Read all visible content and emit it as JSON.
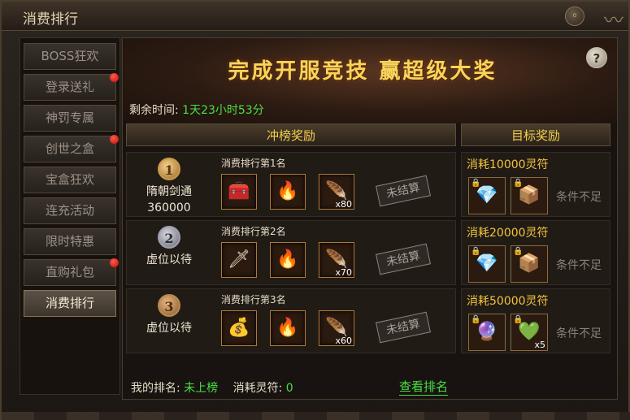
{
  "window": {
    "title": "消费排行",
    "close_glyph": "◦"
  },
  "sidebar": {
    "items": [
      {
        "label": "BOSS狂欢",
        "dot": false,
        "active": false
      },
      {
        "label": "登录送礼",
        "dot": true,
        "active": false
      },
      {
        "label": "神罚专属",
        "dot": false,
        "active": false
      },
      {
        "label": "创世之盒",
        "dot": true,
        "active": false
      },
      {
        "label": "宝盒狂欢",
        "dot": false,
        "active": false
      },
      {
        "label": "连充活动",
        "dot": false,
        "active": false
      },
      {
        "label": "限时特惠",
        "dot": false,
        "active": false
      },
      {
        "label": "直购礼包",
        "dot": true,
        "active": false
      },
      {
        "label": "消费排行",
        "dot": false,
        "active": true
      }
    ]
  },
  "banner": {
    "title": "完成开服竞技  赢超级大奖",
    "help_glyph": "?",
    "remaining_label": "剩余时间:",
    "remaining_value": "1天23小时53分"
  },
  "columns": {
    "rank_rewards": "冲榜奖励",
    "target_rewards": "目标奖励"
  },
  "ranks": [
    {
      "medal": "1",
      "medal_style": "gold",
      "player": "隋朝剑通",
      "score": "360000",
      "label": "消费排行第1名",
      "items": [
        {
          "icon": "treasure-chest-icon",
          "glyph": "🧰",
          "qty": ""
        },
        {
          "icon": "fire-orb-icon",
          "glyph": "🔥",
          "qty": ""
        },
        {
          "icon": "feather-blade-icon",
          "glyph": "🪶",
          "qty": "x80"
        }
      ],
      "status": "未结算"
    },
    {
      "medal": "2",
      "medal_style": "silver",
      "player": "虚位以待",
      "score": "",
      "label": "消费排行第2名",
      "items": [
        {
          "icon": "sword-crate-icon",
          "glyph": "🗡",
          "qty": ""
        },
        {
          "icon": "fire-orb-icon",
          "glyph": "🔥",
          "qty": ""
        },
        {
          "icon": "feather-blade-icon",
          "glyph": "🪶",
          "qty": "x70"
        }
      ],
      "status": "未结算"
    },
    {
      "medal": "3",
      "medal_style": "bronze",
      "player": "虚位以待",
      "score": "",
      "label": "消费排行第3名",
      "items": [
        {
          "icon": "gold-chest-icon",
          "glyph": "💰",
          "qty": ""
        },
        {
          "icon": "fire-orb-icon",
          "glyph": "🔥",
          "qty": ""
        },
        {
          "icon": "feather-blade-icon",
          "glyph": "🪶",
          "qty": "x60"
        }
      ],
      "status": "未结算"
    }
  ],
  "targets": [
    {
      "label": "消耗10000灵符",
      "items": [
        {
          "icon": "crystal-feather-icon",
          "glyph": "💎",
          "qty": "",
          "locked": true
        },
        {
          "icon": "wooden-chest-icon",
          "glyph": "📦",
          "qty": "",
          "locked": true
        }
      ],
      "condition": "条件不足"
    },
    {
      "label": "消耗20000灵符",
      "items": [
        {
          "icon": "crystal-feather-icon",
          "glyph": "💎",
          "qty": "",
          "locked": true
        },
        {
          "icon": "wooden-chest-icon",
          "glyph": "📦",
          "qty": "",
          "locked": true
        }
      ],
      "condition": "条件不足"
    },
    {
      "label": "消耗50000灵符",
      "items": [
        {
          "icon": "purple-gem-icon",
          "glyph": "🔮",
          "qty": "",
          "locked": true
        },
        {
          "icon": "green-gem-icon",
          "glyph": "💚",
          "qty": "x5",
          "locked": true
        }
      ],
      "condition": "条件不足"
    }
  ],
  "footer": {
    "my_rank_label": "我的排名:",
    "my_rank_value": "未上榜",
    "spent_label": "消耗灵符:",
    "spent_value": "0",
    "view_rank": "查看排名"
  }
}
